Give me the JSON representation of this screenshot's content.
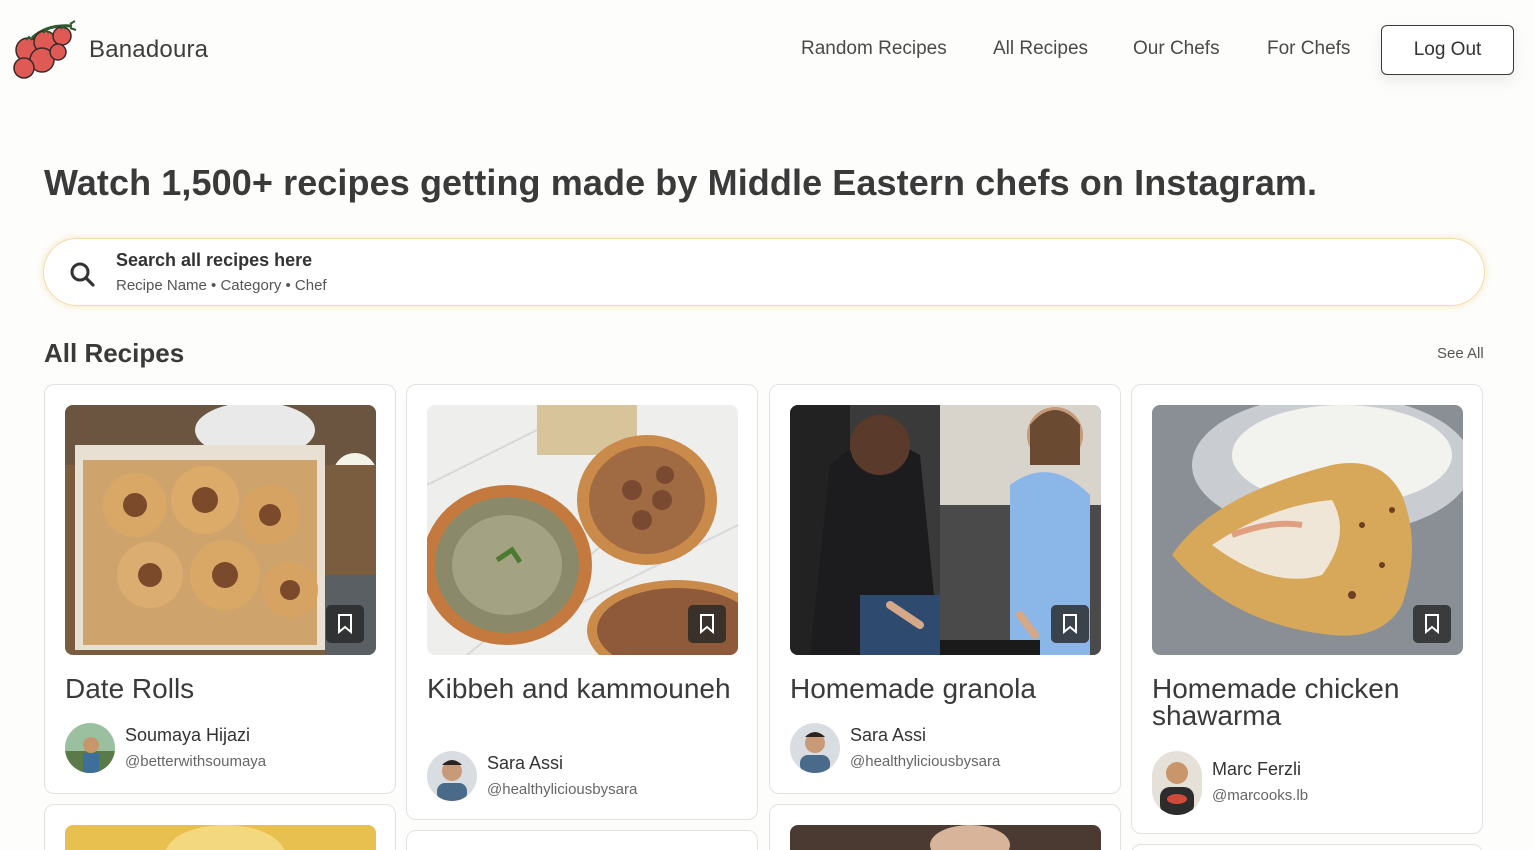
{
  "brand": {
    "name": "Banadoura",
    "logo_icon": "tomato-vine-icon"
  },
  "nav": {
    "links": [
      "Random Recipes",
      "All Recipes",
      "Our Chefs",
      "For Chefs"
    ],
    "logout_label": "Log Out"
  },
  "hero": {
    "headline": "Watch 1,500+ recipes getting made by Middle Eastern chefs on Instagram."
  },
  "search": {
    "title": "Search all recipes here",
    "subtitle": "Recipe Name • Category • Chef",
    "icon": "search-icon"
  },
  "section": {
    "title": "All Recipes",
    "see_all": "See All"
  },
  "recipes": [
    {
      "title": "Date Rolls",
      "chef_name": "Soumaya Hijazi",
      "chef_handle": "@betterwithsoumaya"
    },
    {
      "title": "Kibbeh and kammouneh",
      "chef_name": "Sara Assi",
      "chef_handle": "@healthyliciousbysara"
    },
    {
      "title": "Homemade granola",
      "chef_name": "Sara Assi",
      "chef_handle": "@healthyliciousbysara"
    },
    {
      "title": "Homemade chicken shawarma",
      "chef_name": "Marc Ferzli",
      "chef_handle": "@marcooks.lb"
    }
  ],
  "colors": {
    "background": "#fdfdfb",
    "text": "#3a3a3a",
    "search_border": "#f2dcae",
    "tomato": "#e05a55"
  }
}
